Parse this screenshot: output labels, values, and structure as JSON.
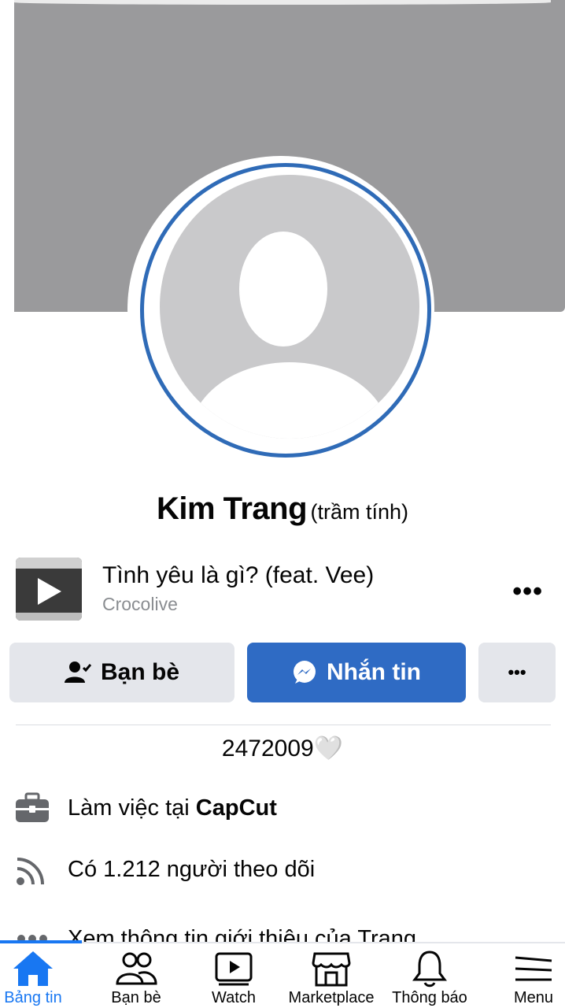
{
  "profile": {
    "name": "Kim Trang",
    "nickname": "(trầm tính)",
    "bio": "2472009🤍"
  },
  "music": {
    "title": "Tình yêu là gì? (feat. Vee)",
    "artist": "Crocolive",
    "more_label": "•••"
  },
  "actions": {
    "friends_label": "Bạn bè",
    "message_label": "Nhắn tin",
    "more_label": "•••"
  },
  "info": {
    "work_prefix": "Làm việc tại ",
    "work_place": "CapCut",
    "followers_text": "Có 1.212 người theo dõi",
    "about_text": "Xem thông tin giới thiệu của Trang"
  },
  "nav": {
    "home_label": "Bảng tin",
    "friends_label": "Bạn bè",
    "watch_label": "Watch",
    "marketplace_label": "Marketplace",
    "notifications_label": "Thông báo",
    "menu_label": "Menu"
  },
  "colors": {
    "accent": "#1877f2",
    "message_button": "#2f6bc4",
    "avatar_ring": "#2f6bb7",
    "cover": "#9a9a9c"
  }
}
